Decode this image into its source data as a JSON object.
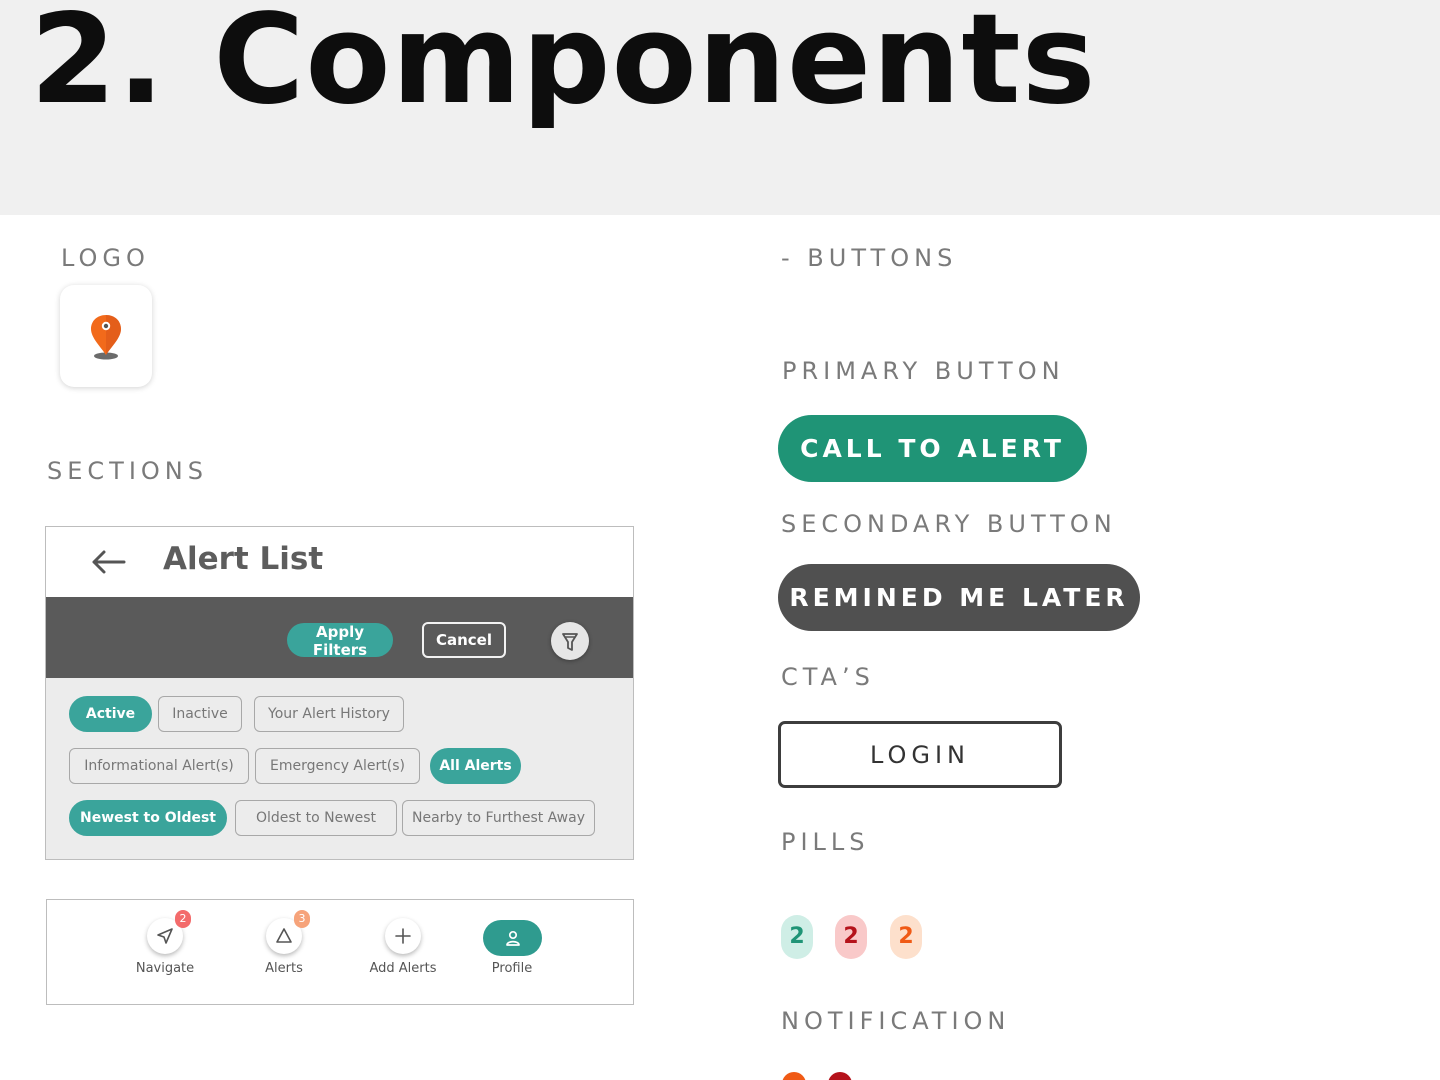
{
  "header": {
    "number": "2.",
    "title": "Components"
  },
  "labels": {
    "logo": "LOGO",
    "sections": "SECTIONS",
    "buttons": "- BUTTONS",
    "primary": "PRIMARY BUTTON",
    "secondary": "SECONDARY BUTTON",
    "ctas": "CTA’S",
    "pills": "PILLS",
    "notification": "NOTIFICATION"
  },
  "alert_list": {
    "title": "Alert List",
    "apply_filters": "Apply Filters",
    "cancel": "Cancel",
    "chips": {
      "active": "Active",
      "inactive": "Inactive",
      "history": "Your Alert History",
      "informational": "Informational Alert(s)",
      "emergency": "Emergency Alert(s)",
      "all": "All Alerts",
      "newest": "Newest to Oldest",
      "oldest": "Oldest to Newest",
      "nearby": "Nearby to Furthest Away"
    }
  },
  "bottom_nav": {
    "navigate": {
      "label": "Navigate",
      "badge": "2"
    },
    "alerts": {
      "label": "Alerts",
      "badge": "3"
    },
    "add_alerts": {
      "label": "Add Alerts"
    },
    "profile": {
      "label": "Profile"
    }
  },
  "buttons": {
    "primary": "CALL TO ALERT",
    "secondary": "REMINED ME LATER",
    "cta": "LOGIN"
  },
  "pills": [
    {
      "value": "2",
      "bg": "#cfeee6",
      "color": "#1f9476"
    },
    {
      "value": "2",
      "bg": "#f9c9c9",
      "color": "#b5121b"
    },
    {
      "value": "2",
      "bg": "#fde0cc",
      "color": "#f05a15"
    }
  ],
  "colors": {
    "primary": "#1f9476",
    "secondary": "#505050",
    "teal_chip": "#3aa49b",
    "logo_pin": "#f26a1b",
    "notification_orange": "#f05a15",
    "notification_red": "#b5121b"
  }
}
